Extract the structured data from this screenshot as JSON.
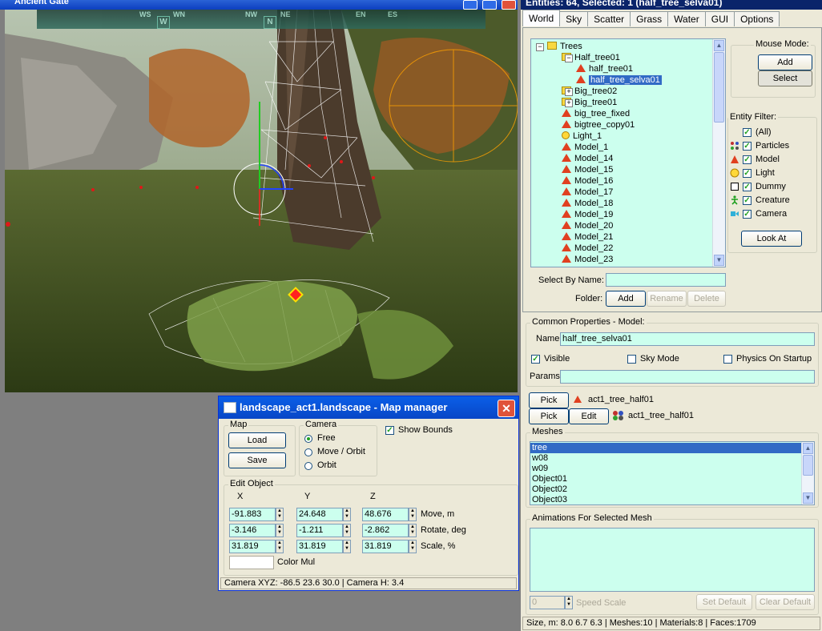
{
  "app": {
    "window_title": "Ancient Gate"
  },
  "viewport": {
    "compass": [
      {
        "label": "WS",
        "kind": "text"
      },
      {
        "label": "W",
        "kind": "marker"
      },
      {
        "label": "WN",
        "kind": "text"
      },
      {
        "label": "NW",
        "kind": "text"
      },
      {
        "label": "N",
        "kind": "marker"
      },
      {
        "label": "NE",
        "kind": "text"
      },
      {
        "label": "EN",
        "kind": "text"
      },
      {
        "label": "ES",
        "kind": "text"
      }
    ]
  },
  "panel": {
    "header": "Entities: 64, Selected: 1 (half_tree_selva01)",
    "tabs": [
      "World",
      "Sky",
      "Scatter",
      "Grass",
      "Water",
      "GUI",
      "Options"
    ],
    "active_tab": "World",
    "tree": [
      {
        "label": "Trees",
        "icon": "folder",
        "expander": "-",
        "level": 0
      },
      {
        "label": "Half_tree01",
        "icon": "folder",
        "expander": "-",
        "level": 1
      },
      {
        "label": "half_tree01",
        "icon": "model",
        "level": 2
      },
      {
        "label": "half_tree_selva01",
        "icon": "model",
        "level": 2,
        "selected": true
      },
      {
        "label": "Big_tree02",
        "icon": "folder",
        "expander": "+",
        "level": 1
      },
      {
        "label": "Big_tree01",
        "icon": "folder",
        "expander": "+",
        "level": 1
      },
      {
        "label": "big_tree_fixed",
        "icon": "model",
        "level": 1
      },
      {
        "label": "bigtree_copy01",
        "icon": "model",
        "level": 1
      },
      {
        "label": "Light_1",
        "icon": "light",
        "level": 1
      },
      {
        "label": "Model_1",
        "icon": "model",
        "level": 1
      },
      {
        "label": "Model_14",
        "icon": "model",
        "level": 1
      },
      {
        "label": "Model_15",
        "icon": "model",
        "level": 1
      },
      {
        "label": "Model_16",
        "icon": "model",
        "level": 1
      },
      {
        "label": "Model_17",
        "icon": "model",
        "level": 1
      },
      {
        "label": "Model_18",
        "icon": "model",
        "level": 1
      },
      {
        "label": "Model_19",
        "icon": "model",
        "level": 1
      },
      {
        "label": "Model_20",
        "icon": "model",
        "level": 1
      },
      {
        "label": "Model_21",
        "icon": "model",
        "level": 1
      },
      {
        "label": "Model_22",
        "icon": "model",
        "level": 1
      },
      {
        "label": "Model_23",
        "icon": "model",
        "level": 1
      }
    ],
    "mouse_mode": {
      "title": "Mouse Mode:",
      "add": "Add",
      "select": "Select"
    },
    "entity_filter": {
      "title": "Entity Filter:",
      "items": [
        {
          "label": "(All)",
          "icon": "none"
        },
        {
          "label": "Particles",
          "icon": "particles"
        },
        {
          "label": "Model",
          "icon": "model"
        },
        {
          "label": "Light",
          "icon": "light"
        },
        {
          "label": "Dummy",
          "icon": "dummy"
        },
        {
          "label": "Creature",
          "icon": "creature"
        },
        {
          "label": "Camera",
          "icon": "camera"
        }
      ],
      "look_at": "Look At"
    },
    "select_by_name": {
      "label": "Select By Name:",
      "value": ""
    },
    "folder": {
      "label": "Folder:",
      "add": "Add",
      "rename": "Rename",
      "delete": "Delete"
    },
    "common": {
      "title": "Common Properties - Model:",
      "name_label": "Name:",
      "name_value": "half_tree_selva01",
      "visible": "Visible",
      "sky_mode": "Sky Mode",
      "physics": "Physics On Startup",
      "params_label": "Params:",
      "params_value": ""
    },
    "pick1": {
      "button": "Pick",
      "value": "act1_tree_half01"
    },
    "pick2": {
      "button": "Pick",
      "edit": "Edit",
      "value": "act1_tree_half01"
    },
    "meshes": {
      "title": "Meshes",
      "items": [
        "tree",
        "w08",
        "w09",
        "Object01",
        "Object02",
        "Object03"
      ],
      "selected": "tree"
    },
    "animations": {
      "title": "Animations For Selected Mesh"
    },
    "speed": {
      "value": "0",
      "label": "Speed Scale",
      "set_default": "Set Default",
      "clear_default": "Clear Default"
    },
    "status": "Size, m:  8.0  6.7  6.3  | Meshes:10  | Materials:8  | Faces:1709"
  },
  "map_manager": {
    "title": "landscape_act1.landscape - Map manager",
    "map_group": "Map",
    "load": "Load",
    "save": "Save",
    "camera_group": "Camera",
    "camera_options": [
      "Free",
      "Move / Orbit",
      "Orbit"
    ],
    "camera_selected": "Free",
    "show_bounds": "Show Bounds",
    "edit_group": "Edit Object",
    "col_x": "X",
    "col_y": "Y",
    "col_z": "Z",
    "move": {
      "label": "Move, m",
      "x": "-91.883",
      "y": "24.648",
      "z": "48.676"
    },
    "rotate": {
      "label": "Rotate, deg",
      "x": "-3.146",
      "y": "-1.211",
      "z": "-2.862"
    },
    "scale": {
      "label": "Scale, %",
      "x": "31.819",
      "y": "31.819",
      "z": "31.819"
    },
    "color_mul": "Color Mul",
    "status": "Camera XYZ:  -86.5  23.6  30.0   | Camera H:  3.4"
  },
  "colors": {
    "accent": "#316ac5",
    "field_bg": "#ccffee",
    "panel_bg": "#ece9d8"
  }
}
